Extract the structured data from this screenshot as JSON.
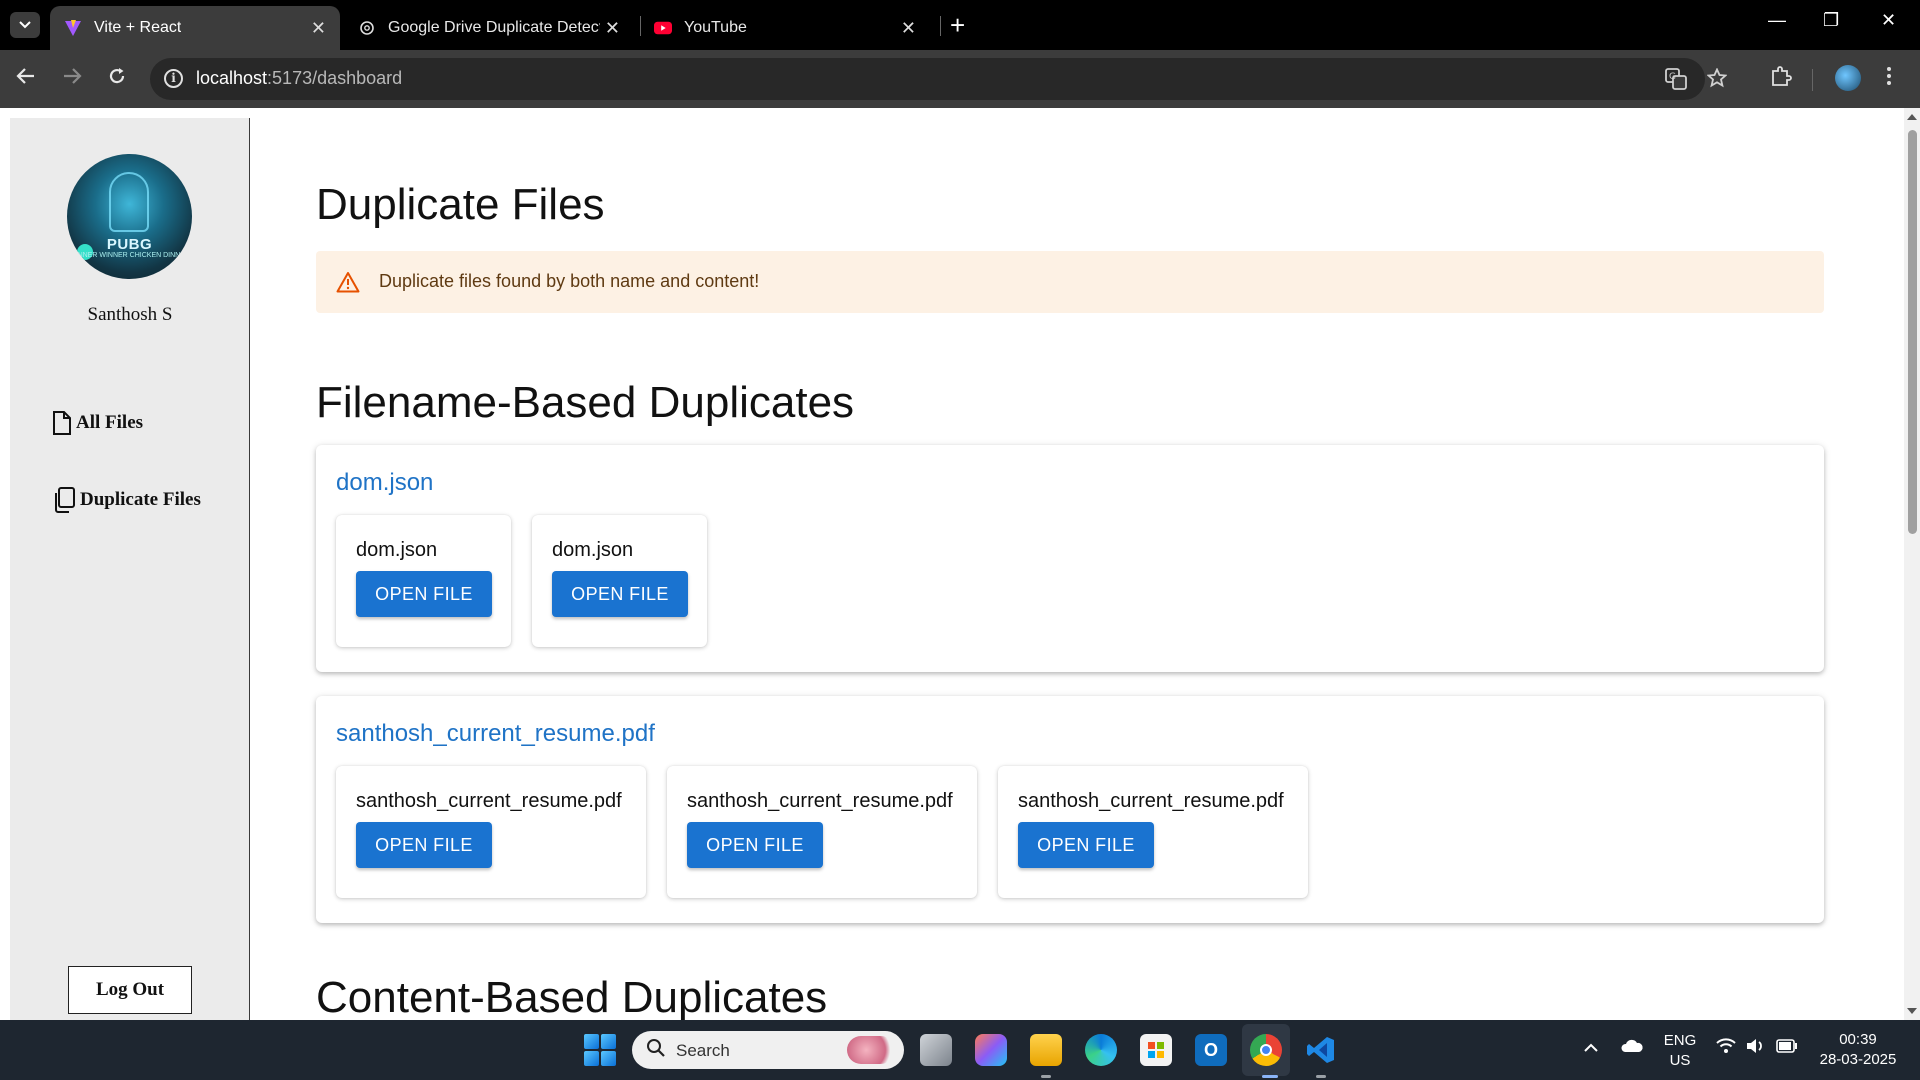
{
  "browser": {
    "tabs": [
      {
        "title": "Vite + React",
        "active": true
      },
      {
        "title": "Google Drive Duplicate Detectio",
        "active": false
      },
      {
        "title": "YouTube",
        "active": false
      }
    ],
    "new_tab_symbol": "+",
    "url_host": "localhost",
    "url_path": ":5173/dashboard",
    "window_controls": {
      "minimize": "—",
      "restore": "❐",
      "close": "✕"
    }
  },
  "sidebar": {
    "username": "Santhosh S",
    "avatar_text": "PUBG",
    "avatar_subtext": "WINNER WINNER CHICKEN DINNER",
    "items": [
      {
        "label": "All Files",
        "icon": "file-icon"
      },
      {
        "label": "Duplicate Files",
        "icon": "copy-icon"
      }
    ],
    "logout_label": "Log Out"
  },
  "main": {
    "title": "Duplicate Files",
    "alert": {
      "message": "Duplicate files found by both name and content!",
      "icon": "warning-icon",
      "color": "#e65100"
    },
    "filename_section_title": "Filename-Based Duplicates",
    "content_section_title": "Content-Based Duplicates",
    "groups": [
      {
        "name": "dom.json",
        "files": [
          {
            "name": "dom.json",
            "button": "OPEN FILE"
          },
          {
            "name": "dom.json",
            "button": "OPEN FILE"
          }
        ]
      },
      {
        "name": "santhosh_current_resume.pdf",
        "files": [
          {
            "name": "santhosh_current_resume.pdf",
            "button": "OPEN FILE"
          },
          {
            "name": "santhosh_current_resume.pdf",
            "button": "OPEN FILE"
          },
          {
            "name": "santhosh_current_resume.pdf",
            "button": "OPEN FILE"
          }
        ]
      }
    ],
    "accent_color": "#1a73d0"
  },
  "taskbar": {
    "search_label": "Search",
    "language_line1": "ENG",
    "language_line2": "US",
    "time": "00:39",
    "date": "28-03-2025"
  }
}
